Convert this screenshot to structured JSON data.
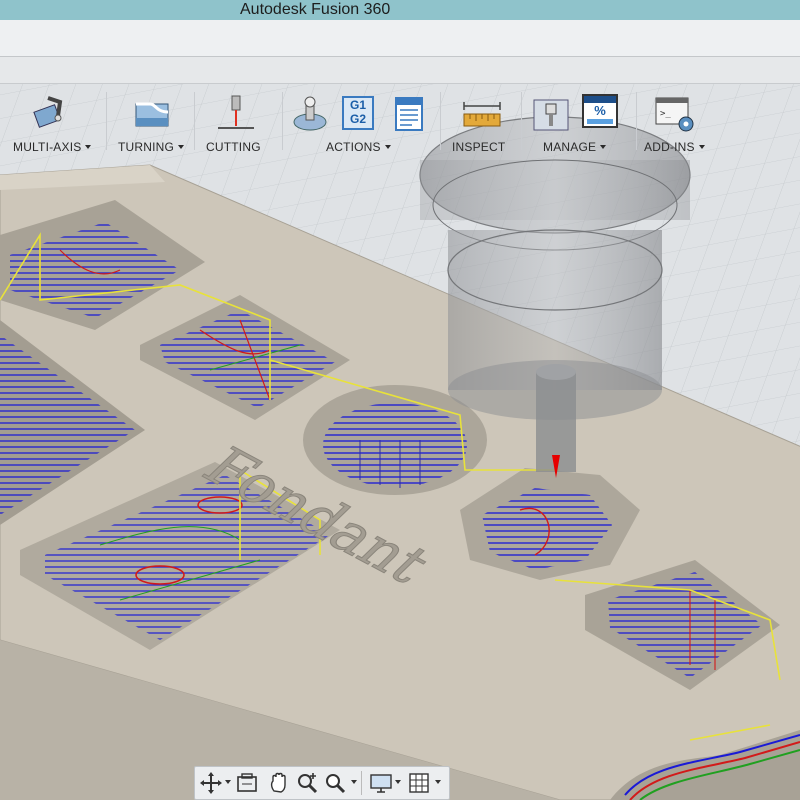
{
  "window": {
    "title": "Autodesk Fusion 360"
  },
  "toolbar": {
    "groups": [
      {
        "label": "MULTI-AXIS",
        "icon": "multi-axis-icon",
        "dropdown": true
      },
      {
        "label": "TURNING",
        "icon": "turning-icon",
        "dropdown": true
      },
      {
        "label": "CUTTING",
        "icon": "cutting-icon",
        "dropdown": false
      },
      {
        "label": "ACTIONS",
        "icon": "actions-icons",
        "dropdown": true
      },
      {
        "label": "INSPECT",
        "icon": "measure-icon",
        "dropdown": false
      },
      {
        "label": "MANAGE",
        "icon": "tool-library-icon",
        "dropdown": true
      },
      {
        "label": "ADD-INS",
        "icon": "scripts-icon",
        "dropdown": true
      }
    ],
    "actions_badges": {
      "g_top": "G1",
      "g_bottom": "G2"
    },
    "manage_badge": "%"
  },
  "model": {
    "engraved_text": "Fondant"
  },
  "nav_bar": {
    "tools": [
      "orbit-icon",
      "look-at-icon",
      "pan-icon",
      "zoom-icon",
      "zoom-window-icon",
      "display-settings-icon",
      "grid-settings-icon"
    ]
  },
  "colors": {
    "titlebar": "#8fc3cb",
    "part": "#c9c2b5",
    "toolpath_blue": "#1a1ad6",
    "toolpath_red": "#d21a1a",
    "rapid_yellow": "#e8e23a",
    "tool_marker": "#e60000"
  }
}
